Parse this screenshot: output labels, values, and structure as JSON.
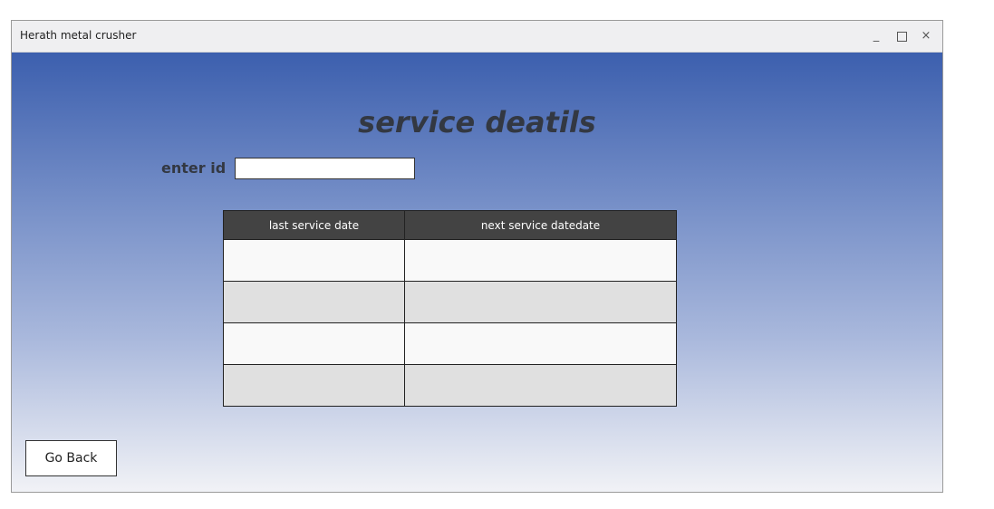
{
  "window": {
    "title": "Herath metal crusher",
    "controls": {
      "minimize": "_",
      "maximize": "",
      "close": "×"
    }
  },
  "page": {
    "heading": "service deatils",
    "id_label": "enter id",
    "id_input": {
      "value": "",
      "placeholder": ""
    }
  },
  "table": {
    "headers": [
      "last service date",
      "next service datedate"
    ],
    "rows": [
      [
        "",
        ""
      ],
      [
        "",
        ""
      ],
      [
        "",
        ""
      ],
      [
        "",
        ""
      ]
    ]
  },
  "buttons": {
    "back": "Go Back"
  },
  "colors": {
    "gradient_top": "#3c5fae",
    "gradient_bottom": "#f1f2f6",
    "table_header": "#434343",
    "heading_text": "#333842"
  }
}
